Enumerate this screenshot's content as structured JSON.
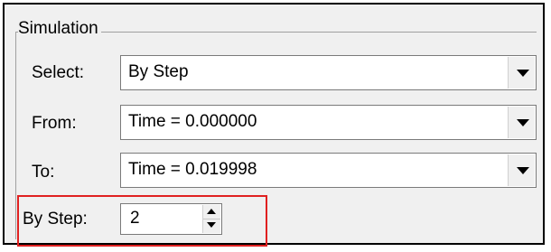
{
  "group": {
    "title": "Simulation"
  },
  "rows": {
    "select": {
      "label": "Select:",
      "value": "By Step"
    },
    "from": {
      "label": "From:",
      "value": "Time = 0.000000"
    },
    "to": {
      "label": "To:",
      "value": "Time = 0.019998"
    },
    "by_step": {
      "label": "By Step:",
      "value": "2"
    }
  },
  "colors": {
    "highlight": "#e02020",
    "panel_bg": "#f0f0f0"
  },
  "icons": {
    "dropdown": "chevron-down-icon",
    "spinner_up": "arrow-up-icon",
    "spinner_down": "arrow-down-icon"
  }
}
